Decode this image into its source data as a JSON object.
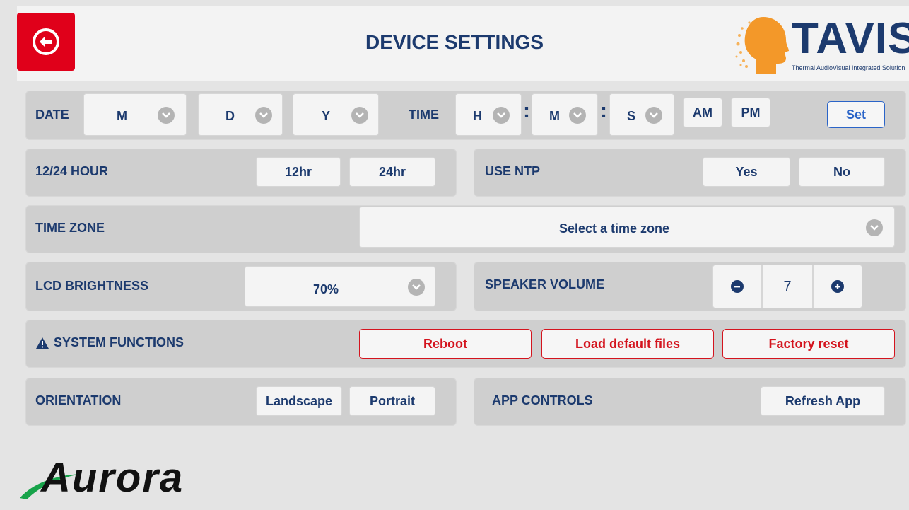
{
  "header": {
    "title": "DEVICE SETTINGS",
    "logo_word": "TAVIS",
    "logo_tagline": "Thermal AudioVisual Integrated Solution"
  },
  "date_time": {
    "date_label": "DATE",
    "month": "M",
    "day": "D",
    "year": "Y",
    "time_label": "TIME",
    "hour": "H",
    "minute": "M",
    "second": "S",
    "colon": ":",
    "am": "AM",
    "pm": "PM",
    "set": "Set"
  },
  "hour_format": {
    "label": "12/24 HOUR",
    "opt_12": "12hr",
    "opt_24": "24hr"
  },
  "ntp": {
    "label": "USE NTP",
    "yes": "Yes",
    "no": "No"
  },
  "time_zone": {
    "label": "TIME ZONE",
    "placeholder": "Select a time zone"
  },
  "brightness": {
    "label": "LCD BRIGHTNESS",
    "value": "70%"
  },
  "volume": {
    "label": "SPEAKER VOLUME",
    "value": "7"
  },
  "system": {
    "label": "SYSTEM FUNCTIONS",
    "reboot": "Reboot",
    "load_defaults": "Load default files",
    "factory_reset": "Factory reset"
  },
  "orientation": {
    "label": "ORIENTATION",
    "landscape": "Landscape",
    "portrait": "Portrait"
  },
  "app_controls": {
    "label": "APP CONTROLS",
    "refresh": "Refresh App"
  },
  "footer": {
    "brand": "Aurora"
  },
  "colors": {
    "navy": "#1c3a6e",
    "red": "#e0001a",
    "blue": "#2a64c8"
  }
}
